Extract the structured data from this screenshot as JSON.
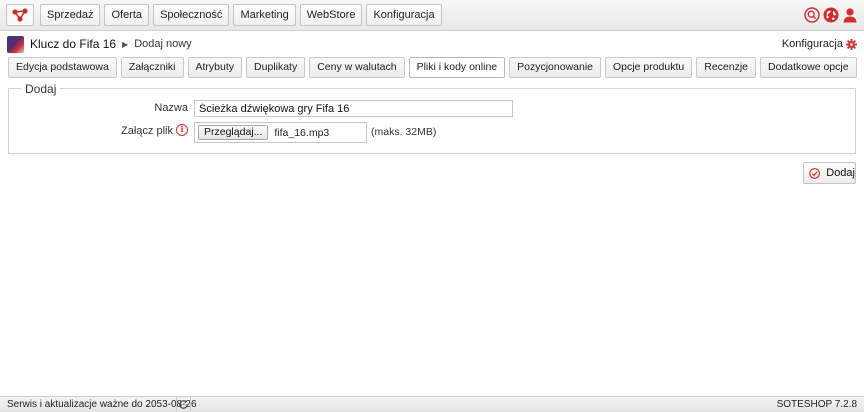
{
  "nav": {
    "items": [
      {
        "label": "Sprzedaż"
      },
      {
        "label": "Oferta"
      },
      {
        "label": "Społeczność"
      },
      {
        "label": "Marketing"
      },
      {
        "label": "WebStore"
      },
      {
        "label": "Konfiguracja"
      }
    ],
    "icons": [
      "search-icon",
      "globe-icon",
      "user-icon"
    ]
  },
  "breadcrumb": {
    "product": "Klucz do Fifa 16",
    "current": "Dodaj nowy"
  },
  "config_link": "Konfiguracja",
  "tabs": [
    {
      "label": "Edycja podstawowa"
    },
    {
      "label": "Załączniki"
    },
    {
      "label": "Atrybuty"
    },
    {
      "label": "Duplikaty"
    },
    {
      "label": "Ceny w walutach"
    },
    {
      "label": "Pliki i kody online",
      "active": true
    },
    {
      "label": "Pozycjonowanie"
    },
    {
      "label": "Opcje produktu"
    },
    {
      "label": "Recenzje"
    },
    {
      "label": "Dodatkowe opcje"
    }
  ],
  "form": {
    "legend": "Dodaj",
    "name_label": "Nazwa",
    "name_value": "Ścieżka dźwiękowa gry Fifa 16",
    "file_label": "Załącz plik",
    "browse_label": "Przeglądaj...",
    "file_name": "fifa_16.mp3",
    "max_size": "(maks. 32MB)"
  },
  "actions": {
    "add_label": "Dodaj"
  },
  "footer": {
    "service_text": "Serwis i aktualizacje ważne do 2053-08-26",
    "version": "SOTESHOP 7.2.8"
  },
  "colors": {
    "accent_red": "#d42b2b"
  }
}
